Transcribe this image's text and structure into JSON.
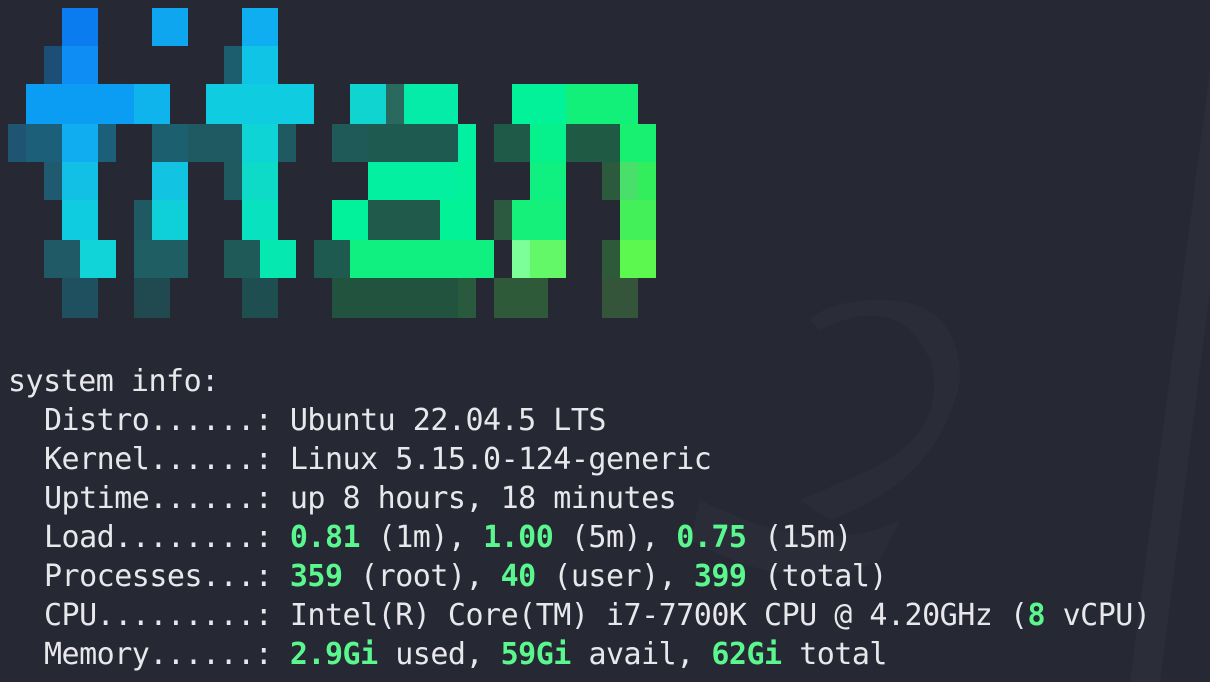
{
  "banner": {
    "text": "titan",
    "gradient_colors": [
      "#0a84ff",
      "#16c5f0",
      "#00e0c8",
      "#00f59a",
      "#33ff66",
      "#66ff55"
    ]
  },
  "colors": {
    "background": "#262933",
    "foreground": "#e8e8ec",
    "highlight": "#5af78e"
  },
  "system_info": {
    "heading": "system info:",
    "rows": {
      "distro": {
        "label": "Distro......:",
        "value": "Ubuntu 22.04.5 LTS"
      },
      "kernel": {
        "label": "Kernel......:",
        "value": "Linux 5.15.0-124-generic"
      },
      "uptime": {
        "label": "Uptime......:",
        "value": "up 8 hours, 18 minutes"
      },
      "load": {
        "label": "Load........:",
        "v1": "0.81",
        "u1": "(1m),",
        "v2": "1.00",
        "u2": "(5m),",
        "v3": "0.75",
        "u3": "(15m)"
      },
      "processes": {
        "label": "Processes...:",
        "v1": "359",
        "u1": "(root),",
        "v2": "40",
        "u2": "(user),",
        "v3": "399",
        "u3": "(total)"
      },
      "cpu": {
        "label": "CPU.........:",
        "model": "Intel(R) Core(TM) i7-7700K CPU @ 4.20GHz (",
        "vcpu_count": "8",
        "vcpu_suffix": "vCPU)"
      },
      "memory": {
        "label": "Memory......:",
        "v1": "2.9Gi",
        "u1": "used,",
        "v2": "59Gi",
        "u2": "avail,",
        "v3": "62Gi",
        "u3": "total"
      }
    }
  }
}
